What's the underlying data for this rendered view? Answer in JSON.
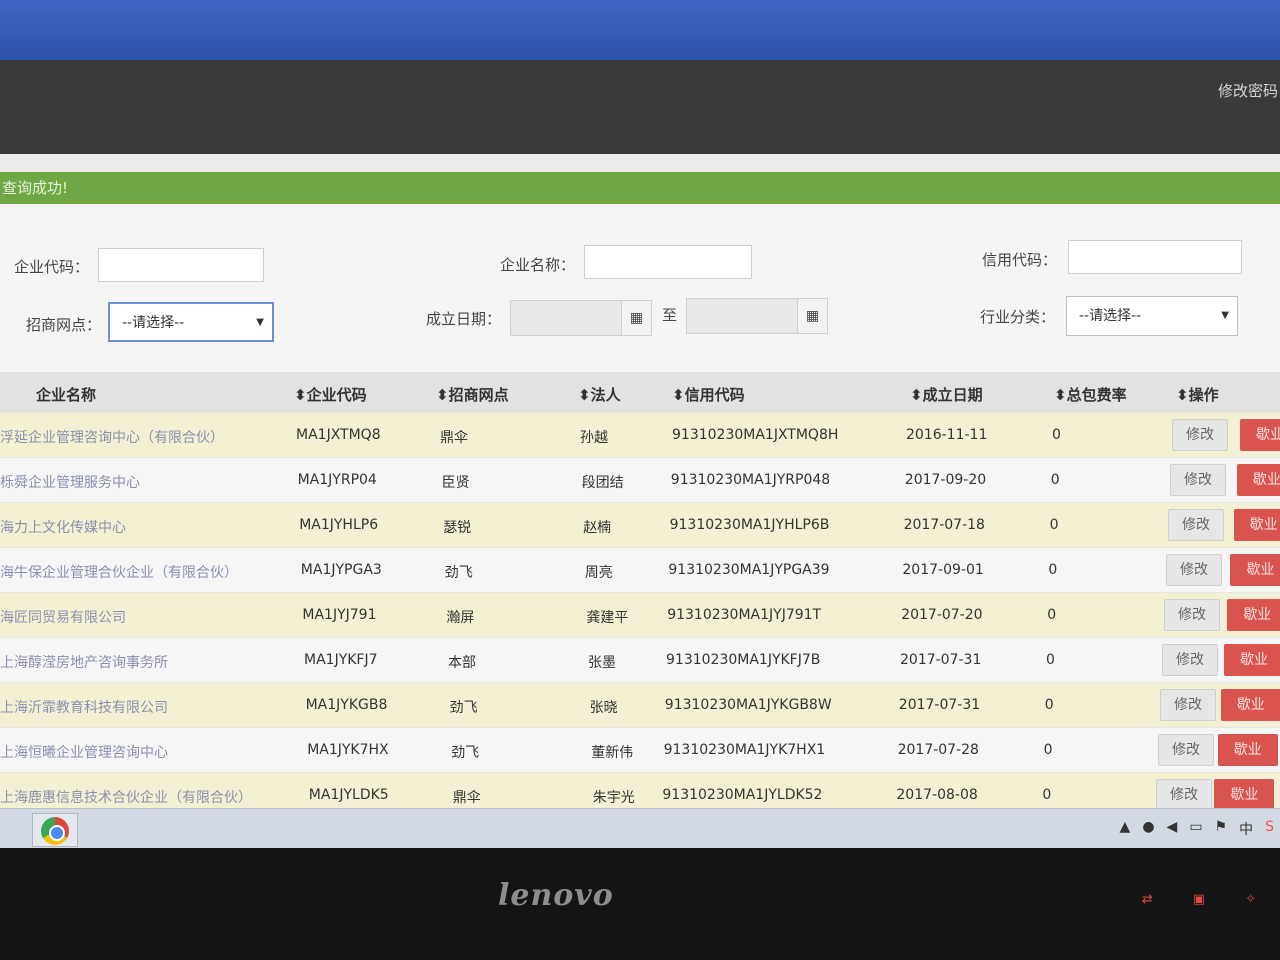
{
  "header": {
    "change_password": "修改密码"
  },
  "alert": {
    "message": "查询成功!"
  },
  "filters": {
    "company_code_label": "企业代码：",
    "company_name_label": "企业名称：",
    "credit_code_label": "信用代码：",
    "branch_label": "招商网点：",
    "branch_value": "--请选择--",
    "found_date_label": "成立日期：",
    "to_label": "至",
    "industry_label": "行业分类：",
    "industry_value": "--请选择--"
  },
  "table": {
    "headers": [
      "企业名称",
      "企业代码",
      "招商网点",
      "法人",
      "信用代码",
      "成立日期",
      "总包费率",
      "操作"
    ],
    "edit_label": "修改",
    "delete_label": "歇业",
    "rows": [
      {
        "name": "浮延企业管理咨询中心（有限合伙）",
        "code": "MA1JXTMQ8",
        "branch": "鼎伞",
        "legal": "孙越",
        "credit": "91310230MA1JXTMQ8H",
        "date": "2016-11-11",
        "rate": "0"
      },
      {
        "name": "栎舜企业管理服务中心",
        "code": "MA1JYRP04",
        "branch": "臣贤",
        "legal": "段团结",
        "credit": "91310230MA1JYRP048",
        "date": "2017-09-20",
        "rate": "0"
      },
      {
        "name": "海力上文化传媒中心",
        "code": "MA1JYHLP6",
        "branch": "瑟锐",
        "legal": "赵楠",
        "credit": "91310230MA1JYHLP6B",
        "date": "2017-07-18",
        "rate": "0"
      },
      {
        "name": "海牛保企业管理合伙企业（有限合伙）",
        "code": "MA1JYPGA3",
        "branch": "劲飞",
        "legal": "周亮",
        "credit": "91310230MA1JYPGA39",
        "date": "2017-09-01",
        "rate": "0"
      },
      {
        "name": "海匠同贸易有限公司",
        "code": "MA1JYJ791",
        "branch": "瀚屏",
        "legal": "龚建平",
        "credit": "91310230MA1JYJ791T",
        "date": "2017-07-20",
        "rate": "0"
      },
      {
        "name": "上海醇滢房地产咨询事务所",
        "code": "MA1JYKFJ7",
        "branch": "本部",
        "legal": "张墨",
        "credit": "91310230MA1JYKFJ7B",
        "date": "2017-07-31",
        "rate": "0"
      },
      {
        "name": "上海沂霏教育科技有限公司",
        "code": "MA1JYKGB8",
        "branch": "劲飞",
        "legal": "张晓",
        "credit": "91310230MA1JYKGB8W",
        "date": "2017-07-31",
        "rate": "0"
      },
      {
        "name": "上海恒曦企业管理咨询中心",
        "code": "MA1JYK7HX",
        "branch": "劲飞",
        "legal": "董新伟",
        "credit": "91310230MA1JYK7HX1",
        "date": "2017-07-28",
        "rate": "0"
      },
      {
        "name": "上海鹿惠信息技术合伙企业（有限合伙）",
        "code": "MA1JYLDK5",
        "branch": "鼎伞",
        "legal": "朱宇光",
        "credit": "91310230MA1JYLDK52",
        "date": "2017-08-08",
        "rate": "0"
      }
    ]
  },
  "taskbar": {
    "ime": "中"
  },
  "monitor": {
    "brand": "lenovo"
  }
}
